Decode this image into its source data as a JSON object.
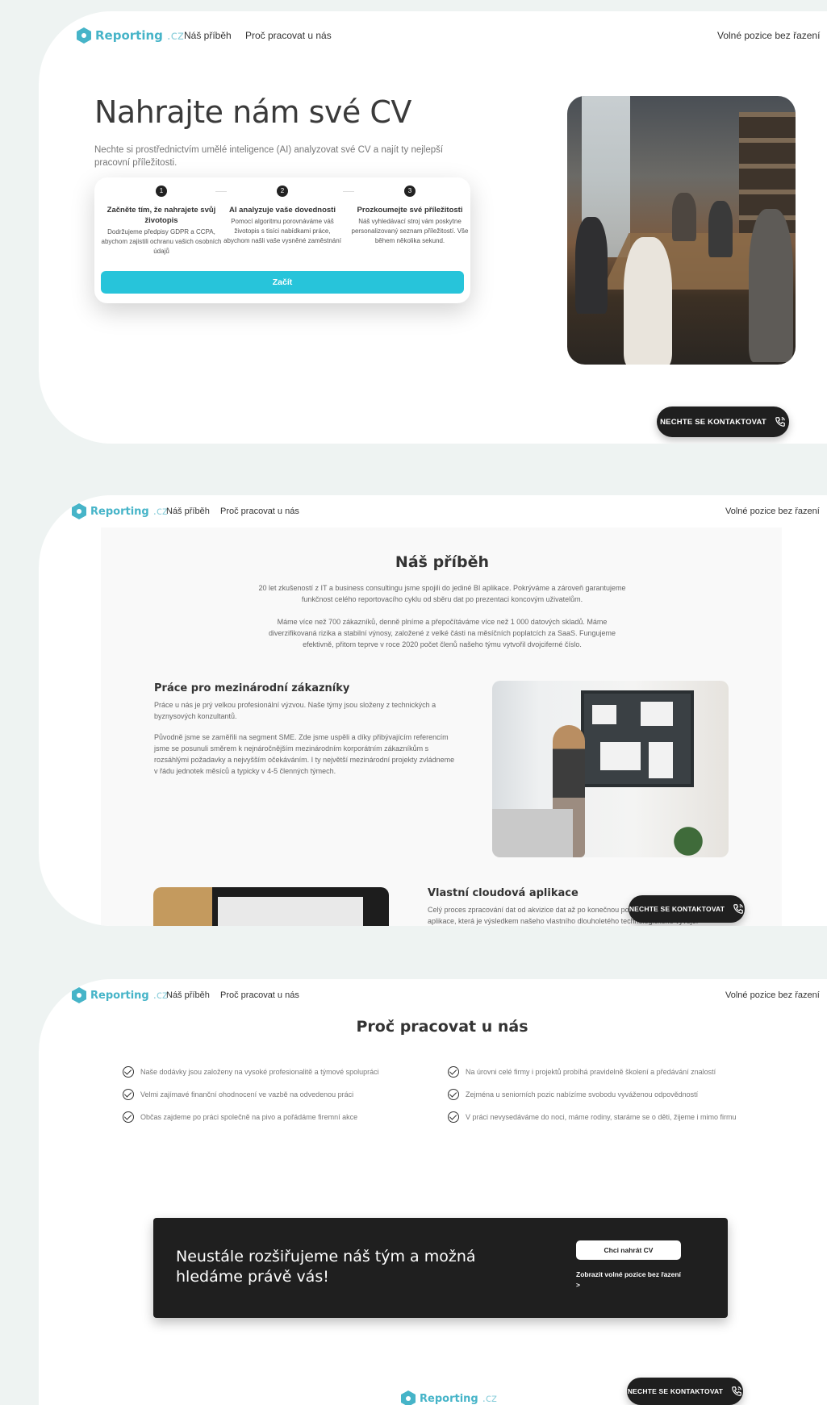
{
  "brand": {
    "name": "Reporting",
    "domain": ".cz",
    "color": "#46b4c8"
  },
  "nav": {
    "story": "Náš příběh",
    "why": "Proč pracovat u nás",
    "jobs": "Volné pozice bez řazení"
  },
  "hero": {
    "title": "Nahrajte nám své CV",
    "subtitle": "Nechte si prostřednictvím umělé inteligence (AI) analyzovat své CV a najít ty nejlepší pracovní příležitosti.",
    "steps": [
      {
        "num": "1",
        "title": "Začněte tím, že nahrajete svůj životopis",
        "desc": "Dodržujeme předpisy GDPR a CCPA, abychom zajistili ochranu vašich osobních údajů"
      },
      {
        "num": "2",
        "title": "AI analyzuje vaše dovednosti",
        "desc": "Pomocí algoritmu porovnáváme váš životopis s tisíci nabídkami práce, abychom našli vaše vysněné zaměstnání"
      },
      {
        "num": "3",
        "title": "Prozkoumejte své příležitosti",
        "desc": "Náš vyhledávací stroj vám poskytne personalizovaný seznam příležitostí. Vše během několika sekund."
      }
    ],
    "cta": "Začít",
    "cta_color": "#27c4da"
  },
  "contact_button": "NECHTE SE KONTAKTOVAT",
  "story": {
    "title": "Náš příběh",
    "p1": "20 let zkušeností z IT a business consultingu jsme spojili do jediné BI aplikace. Pokrýváme a zároveň garantujeme funkčnost celého reportovacího cyklu od sběru dat po prezentaci koncovým uživatelům.",
    "p2": "Máme více než 700 zákazníků, denně plníme a přepočítáváme více než 1 000 datových skladů. Máme diverzifikovaná rizika a stabilní výnosy, založené z velké části na měsíčních poplatcích za SaaS. Fungujeme efektivně, přitom teprve v roce 2020 počet členů našeho týmu vytvořil dvojciferné číslo.",
    "s1_title": "Práce pro mezinárodní zákazníky",
    "s1_p1": "Práce u nás je prý velkou profesionální výzvou. Naše týmy jsou složeny z technických a byznysových konzultantů.",
    "s1_p2": "Původně jsme se zaměřili na segment SME. Zde jsme uspěli a díky přibývajícím referencím jsme se posunuli směrem k nejnáročnějším mezinárodním korporátním zákazníkům s rozsáhlými požadavky a nejvyšším očekáváním. I ty největší mezinárodní projekty zvládneme v řádu jednotek měsíců a typicky v 4-5 členných týmech.",
    "s2_title": "Vlastní cloudová aplikace",
    "s2_p1": "Celý proces zpracování dat od akvizice dat až po konečnou podobu reportů probíhá v rámci aplikace, která je výsledkem našeho vlastního dlouholetého technologického vývoje."
  },
  "why": {
    "title": "Proč pracovat u nás",
    "left": [
      "Naše dodávky jsou založeny na vysoké profesionalitě a týmové spolupráci",
      "Velmi zajímavé finanční ohodnocení ve vazbě na odvedenou práci",
      "Občas zajdeme po práci společně na pivo a pořádáme firemní akce"
    ],
    "right": [
      "Na úrovni celé firmy i projektů probíhá pravidelně školení a předávání znalostí",
      "Zejména u seniorních pozic nabízíme svobodu vyváženou odpovědností",
      "V práci nevysedáváme do noci, máme rodiny, staráme se o děti, žijeme i mimo firmu"
    ]
  },
  "banner": {
    "headline": "Neustále rozšiřujeme náš tým a možná hledáme právě vás!",
    "upload": "Chci nahrát CV",
    "jobs_link": "Zobrazit volné pozice bez řazení >"
  }
}
